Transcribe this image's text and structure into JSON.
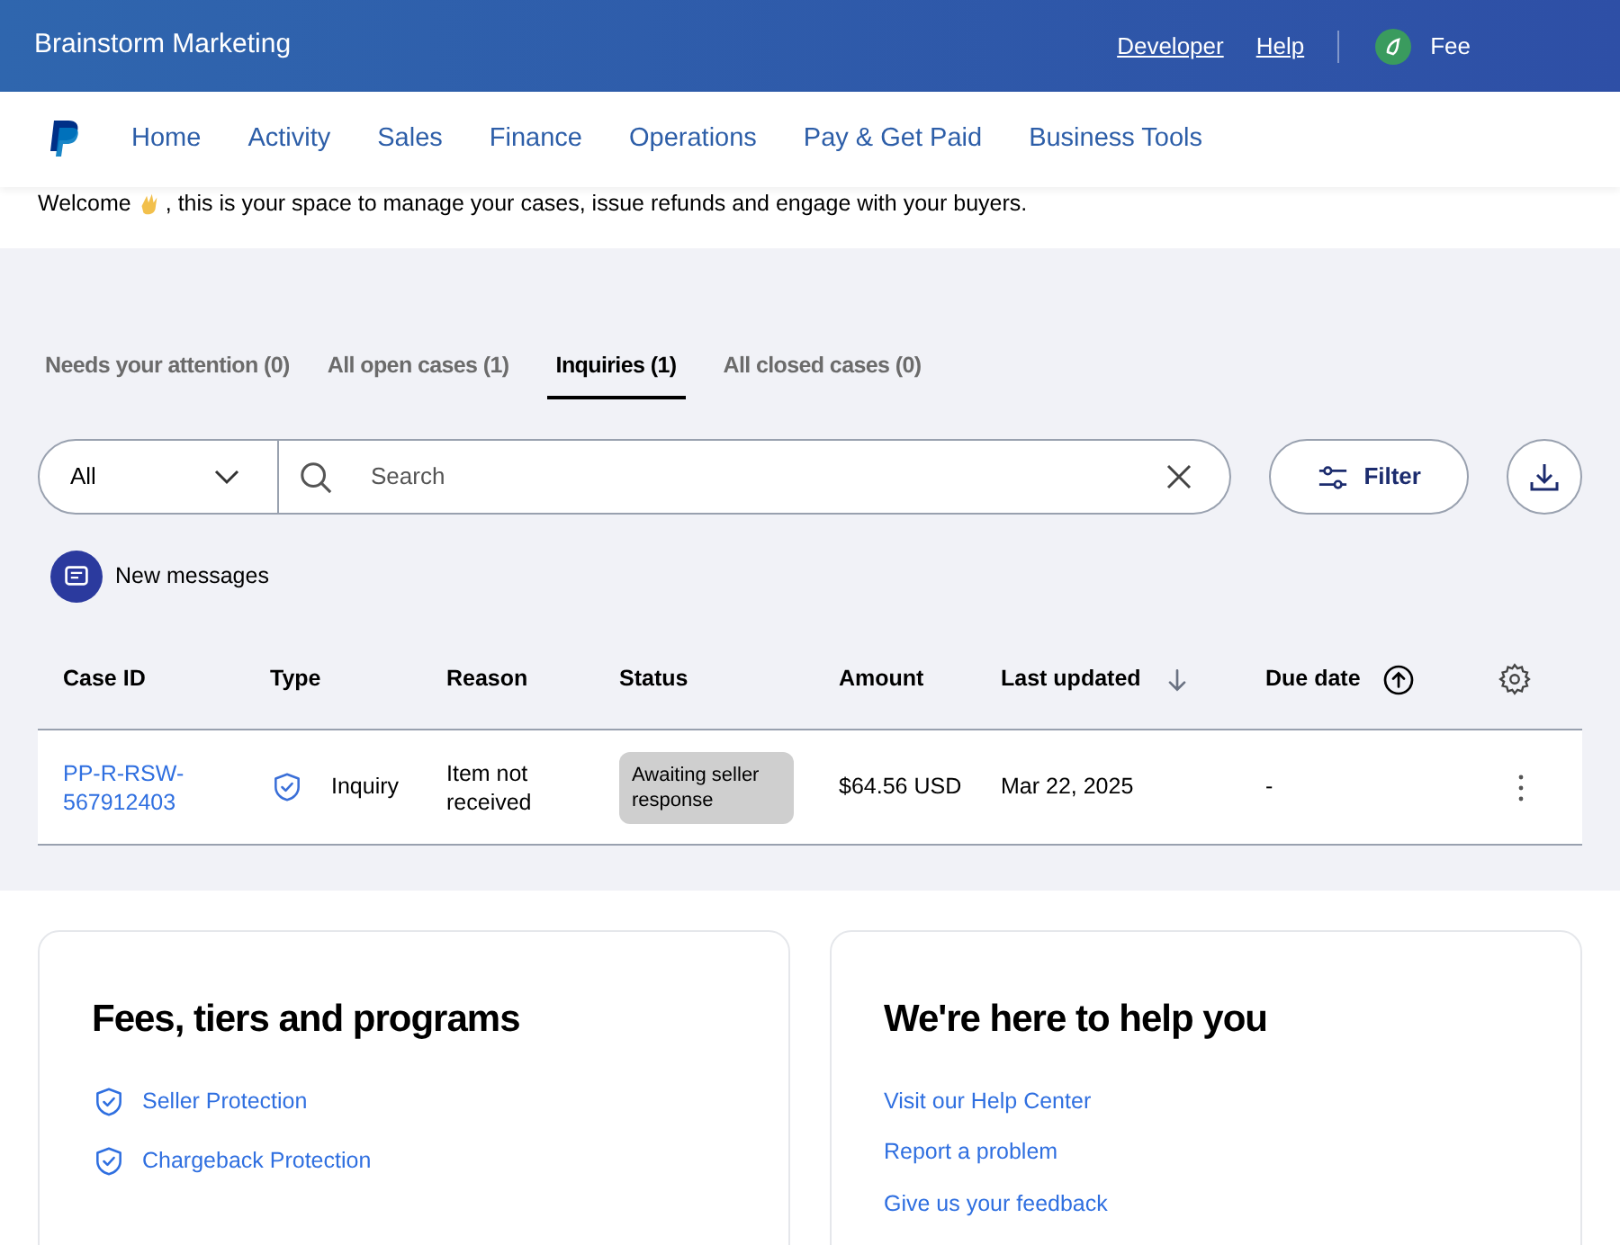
{
  "header": {
    "title": "Brainstorm Marketing",
    "links": [
      "Developer",
      "Help"
    ],
    "user": "Fee"
  },
  "nav": {
    "items": [
      "Home",
      "Activity",
      "Sales",
      "Finance",
      "Operations",
      "Pay & Get Paid",
      "Business Tools"
    ]
  },
  "welcome": {
    "before": "Welcome",
    "after": ", this is your space to manage your cases, issue refunds and engage with your buyers."
  },
  "tabs": [
    {
      "label": "Needs your attention (0)",
      "selected": false
    },
    {
      "label": "All open cases (1)",
      "selected": false
    },
    {
      "label": "Inquiries (1)",
      "selected": true
    },
    {
      "label": "All closed cases (0)",
      "selected": false
    }
  ],
  "filter_bar": {
    "dropdown": "All",
    "search_placeholder": "Search",
    "filter_button": "Filter"
  },
  "new_messages": "New messages",
  "table": {
    "columns": [
      {
        "label": "Case ID",
        "kind": "plain"
      },
      {
        "label": "Type",
        "kind": "plain"
      },
      {
        "label": "Reason",
        "kind": "plain"
      },
      {
        "label": "Status",
        "kind": "plain"
      },
      {
        "label": "Amount",
        "kind": "plain"
      },
      {
        "label": "Last updated",
        "kind": "descending"
      },
      {
        "label": "Due date",
        "kind": "ascending"
      }
    ],
    "rows": [
      {
        "case_id": "PP-R-RSW-567912403",
        "type": "Inquiry",
        "reason": "Item not received",
        "status": "Awaiting seller response",
        "amount": "$64.56 USD",
        "last_updated": "Mar 22, 2025",
        "due_date": "-"
      }
    ]
  },
  "cards": [
    {
      "title": "Fees, tiers and programs",
      "links": [
        {
          "label": "Seller Protection",
          "kind": "shield"
        },
        {
          "label": "Chargeback Protection",
          "kind": "shield"
        }
      ]
    },
    {
      "title": "We're here to help you",
      "links": [
        {
          "label": "Visit our Help Center",
          "kind": "plain"
        },
        {
          "label": "Report a problem",
          "kind": "plain"
        },
        {
          "label": "Give us your feedback",
          "kind": "plain"
        }
      ]
    }
  ]
}
